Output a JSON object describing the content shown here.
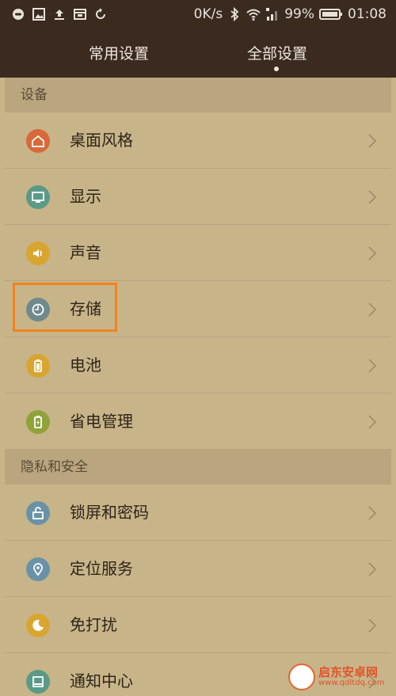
{
  "status_bar": {
    "net_speed": "0K/s",
    "battery": "99%",
    "time": "01:08",
    "icons": [
      "message-icon",
      "image-icon",
      "upload-icon",
      "mail-icon",
      "sync-icon",
      "bluetooth-icon",
      "wifi-icon",
      "signal-icon",
      "battery-icon"
    ]
  },
  "tabs": [
    {
      "label": "常用设置",
      "selected": false
    },
    {
      "label": "全部设置",
      "selected": true
    }
  ],
  "sections": {
    "device": {
      "title": "设备",
      "items": [
        {
          "label": "桌面风格",
          "icon": "home-icon",
          "color": "#d8693a"
        },
        {
          "label": "显示",
          "icon": "monitor-icon",
          "color": "#5a9a86"
        },
        {
          "label": "声音",
          "icon": "speaker-icon",
          "color": "#d8a630"
        },
        {
          "label": "存储",
          "icon": "storage-icon",
          "color": "#6f8a8c"
        },
        {
          "label": "电池",
          "icon": "battery-icon",
          "color": "#d8a630"
        },
        {
          "label": "省电管理",
          "icon": "power-saving-icon",
          "color": "#8fa33a"
        }
      ]
    },
    "privacy": {
      "title": "隐私和安全",
      "items": [
        {
          "label": "锁屏和密码",
          "icon": "lock-icon",
          "color": "#6a92a6"
        },
        {
          "label": "定位服务",
          "icon": "location-icon",
          "color": "#6a92a6"
        },
        {
          "label": "免打扰",
          "icon": "moon-icon",
          "color": "#d8a630"
        },
        {
          "label": "通知中心",
          "icon": "notification-icon",
          "color": "#5a9a86"
        }
      ]
    }
  },
  "watermark": {
    "name": "启东安卓网",
    "url": "www.qdltdq.com"
  }
}
